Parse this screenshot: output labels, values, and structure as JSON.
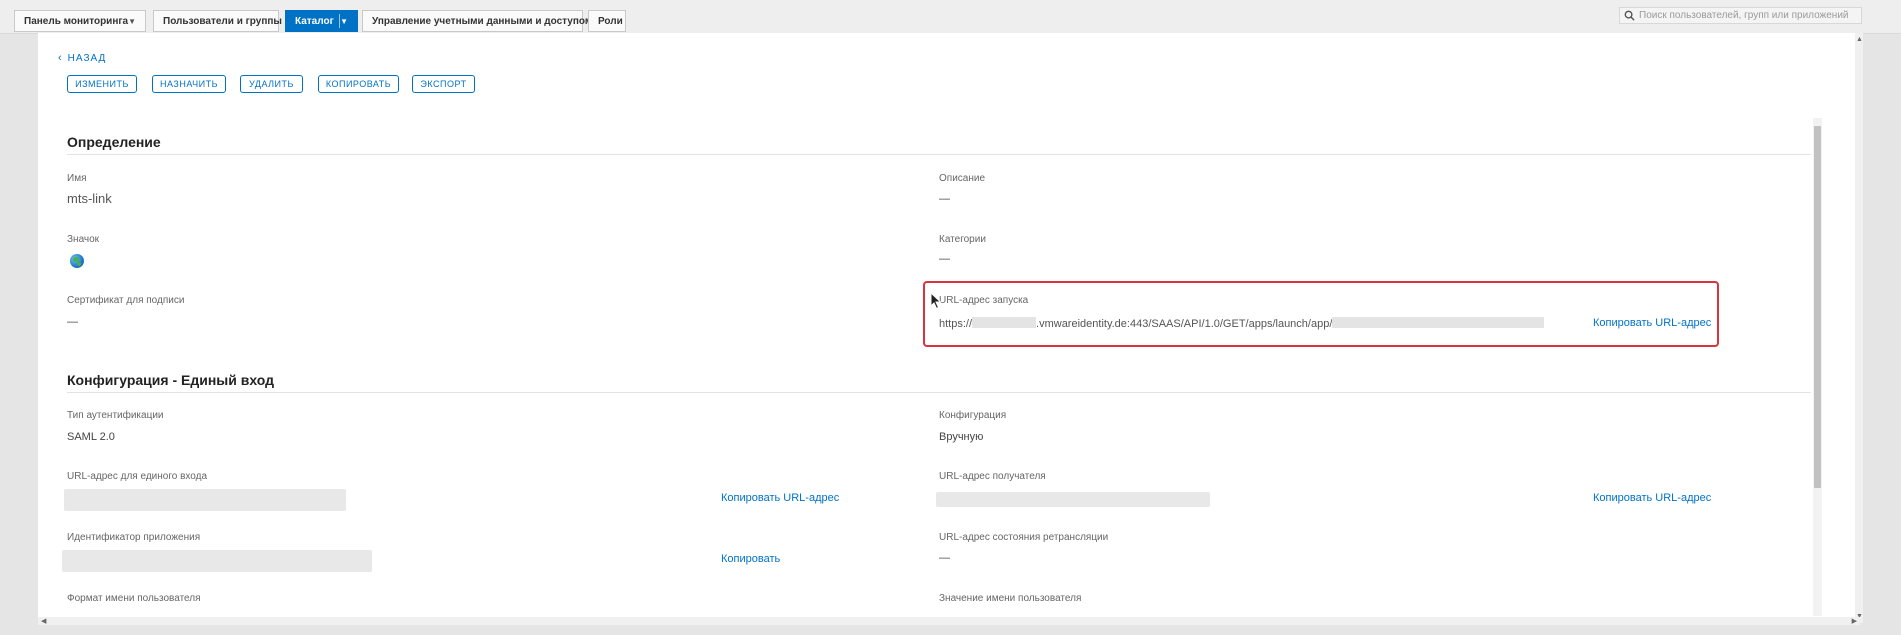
{
  "nav": {
    "tabs": [
      {
        "label": "Панель мониторинга",
        "has_dropdown": true
      },
      {
        "label": "Пользователи и группы"
      },
      {
        "label": "Каталог",
        "has_dropdown": true,
        "active": true
      },
      {
        "label": "Управление учетными данными и доступом"
      },
      {
        "label": "Роли"
      }
    ],
    "search_placeholder": "Поиск пользователей, групп или приложений",
    "search_icon": "search-icon"
  },
  "back_label": "НАЗАД",
  "actions": [
    "ИЗМЕНИТЬ",
    "НАЗНАЧИТЬ",
    "УДАЛИТЬ",
    "КОПИРОВАТЬ",
    "ЭКСПОРТ"
  ],
  "definition": {
    "title": "Определение",
    "name_label": "Имя",
    "name_value": "mts-link",
    "description_label": "Описание",
    "description_value": "—",
    "icon_label": "Значок",
    "icon_name": "globe-icon",
    "categories_label": "Категории",
    "categories_value": "—",
    "signing_cert_label": "Сертификат для подписи",
    "signing_cert_value": "—",
    "launch_url_label": "URL-адрес запуска",
    "launch_url_prefix": "https://",
    "launch_url_middle": ".vmwareidentity.de:443/SAAS/API/1.0/GET/apps/launch/app/",
    "copy_url_label": "Копировать URL-адрес"
  },
  "config": {
    "title": "Конфигурация - Единый вход",
    "auth_type_label": "Тип аутентификации",
    "auth_type_value": "SAML 2.0",
    "configuration_label": "Конфигурация",
    "configuration_value": "Вручную",
    "sso_url_label": "URL-адрес для единого входа",
    "sso_copy_label": "Копировать URL-адрес",
    "recipient_url_label": "URL-адрес получателя",
    "recipient_copy_label": "Копировать URL-адрес",
    "app_id_label": "Идентификатор приложения",
    "app_id_copy_label": "Копировать",
    "relay_state_label": "URL-адрес состояния ретрансляции",
    "relay_state_value": "—",
    "username_format_label": "Формат имени пользователя",
    "username_value_label": "Значение имени пользователя"
  },
  "colors": {
    "accent": "#0072c6",
    "highlight_border": "#d9333b"
  }
}
